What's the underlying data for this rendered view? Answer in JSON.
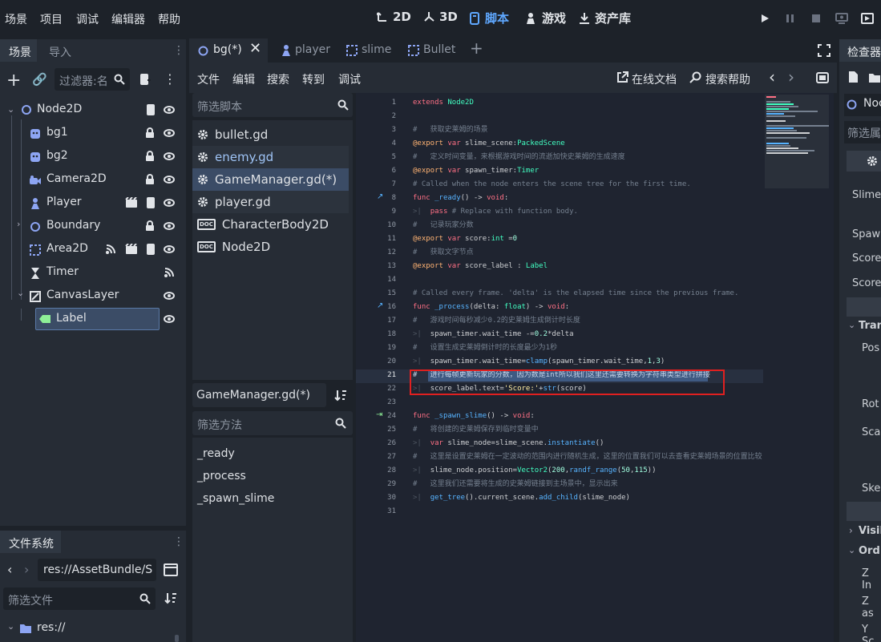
{
  "menu": [
    "场景",
    "项目",
    "调试",
    "编辑器",
    "帮助"
  ],
  "workspaces": [
    {
      "label": "2D",
      "icon": "2d-icon"
    },
    {
      "label": "3D",
      "icon": "3d-icon"
    },
    {
      "label": "脚本",
      "icon": "script-icon",
      "active": true
    },
    {
      "label": "游戏",
      "icon": "game-icon"
    },
    {
      "label": "资产库",
      "icon": "assetlib-icon"
    }
  ],
  "scene_dock": {
    "tabs": [
      "场景",
      "导入"
    ],
    "filter_placeholder": "过滤器:名",
    "nodes": [
      {
        "name": "Node2D"
      },
      {
        "name": "bg1"
      },
      {
        "name": "bg2"
      },
      {
        "name": "Camera2D"
      },
      {
        "name": "Player"
      },
      {
        "name": "Boundary"
      },
      {
        "name": "Area2D"
      },
      {
        "name": "Timer"
      },
      {
        "name": "CanvasLayer"
      },
      {
        "name": "Label",
        "selected": true
      }
    ]
  },
  "filesystem": {
    "title": "文件系统",
    "path": "res://AssetBundle/S",
    "filter_placeholder": "筛选文件",
    "root": "res://"
  },
  "script_tabs": [
    {
      "label": "bg(*)",
      "active": true
    },
    {
      "label": "player"
    },
    {
      "label": "slime"
    },
    {
      "label": "Bullet"
    }
  ],
  "script_menu": [
    "文件",
    "编辑",
    "搜索",
    "转到",
    "调试"
  ],
  "script_toolbar": {
    "online_docs": "在线文档",
    "search_help": "搜索帮助"
  },
  "script_list": {
    "filter_placeholder": "筛选脚本",
    "items": [
      {
        "label": "bullet.gd",
        "type": "gear"
      },
      {
        "label": "enemy.gd",
        "type": "gear",
        "highlight": true
      },
      {
        "label": "GameManager.gd(*)",
        "type": "gear",
        "selected": true
      },
      {
        "label": "player.gd",
        "type": "gear"
      },
      {
        "label": "CharacterBody2D",
        "type": "doc"
      },
      {
        "label": "Node2D",
        "type": "doc"
      }
    ],
    "current": "GameManager.gd(*)",
    "methods_filter_placeholder": "筛选方法",
    "methods": [
      "_ready",
      "_process",
      "_spawn_slime"
    ]
  },
  "code": [
    {
      "n": "1",
      "t": "extends Node2D"
    },
    {
      "n": "2",
      "t": ""
    },
    {
      "n": "3",
      "t": "#   获取史莱姆的场景"
    },
    {
      "n": "4",
      "t": "@export var slime_scene:PackedScene"
    },
    {
      "n": "5",
      "t": "#   定义时间变量，来根据游戏时间的流逝加快史莱姆的生成速度"
    },
    {
      "n": "6",
      "t": "@export var spawn_timer:Timer"
    },
    {
      "n": "7",
      "t": "# Called when the node enters the scene tree for the first time."
    },
    {
      "n": "8",
      "t": "func _ready() -> void:"
    },
    {
      "n": "9",
      "t": "    pass # Replace with function body."
    },
    {
      "n": "10",
      "t": "#   记录玩家分数"
    },
    {
      "n": "11",
      "t": "@export var score:int =0"
    },
    {
      "n": "12",
      "t": "#   获取文字节点"
    },
    {
      "n": "13",
      "t": "@export var score_label : Label"
    },
    {
      "n": "14",
      "t": ""
    },
    {
      "n": "15",
      "t": "# Called every frame. 'delta' is the elapsed time since the previous frame."
    },
    {
      "n": "16",
      "t": "func _process(delta: float) -> void:"
    },
    {
      "n": "17",
      "t": "#   游戏时间每秒减少0.2的史莱姆生成倒计时长度"
    },
    {
      "n": "18",
      "t": "    spawn_timer.wait_time -=0.2*delta"
    },
    {
      "n": "19",
      "t": "#   设置生成史莱姆倒计时的长度最少为1秒"
    },
    {
      "n": "20",
      "t": "    spawn_timer.wait_time=clamp(spawn_timer.wait_time,1,3)"
    },
    {
      "n": "21",
      "t": "#   进行每帧更新玩家的分数，因为数是int所以我们这里还需要转换为字符串类型进行拼接"
    },
    {
      "n": "22",
      "t": "    score_label.text='Score:'+str(score)"
    },
    {
      "n": "23",
      "t": ""
    },
    {
      "n": "24",
      "t": "func _spawn_slime() -> void:"
    },
    {
      "n": "25",
      "t": "#   将创建的史莱姆保存到临时变量中"
    },
    {
      "n": "26",
      "t": "    var slime_node=slime_scene.instantiate()"
    },
    {
      "n": "27",
      "t": "#   这里是设置史莱姆在一定波动的范围内进行随机生成，这里的位置我们可以去查看史莱姆场景的位置比较"
    },
    {
      "n": "28",
      "t": "    slime_node.position=Vector2(200,randf_range(50,115))"
    },
    {
      "n": "29",
      "t": "#   这里我们还需要将生成的史莱姆链接到主场景中，显示出来"
    },
    {
      "n": "30",
      "t": "    get_tree().current_scene.add_child(slime_node)"
    },
    {
      "n": "31",
      "t": ""
    }
  ],
  "inspector": {
    "title": "检查器",
    "node_label": "Noc",
    "filter_placeholder": "筛选属",
    "labels": [
      "Slime",
      "Spaw",
      "Score",
      "Score",
      "Tran",
      "Pos",
      "Rot",
      "Sca",
      "Ske",
      "Visil",
      "Ord",
      "Z In",
      "Z as",
      "Y Sc"
    ]
  }
}
